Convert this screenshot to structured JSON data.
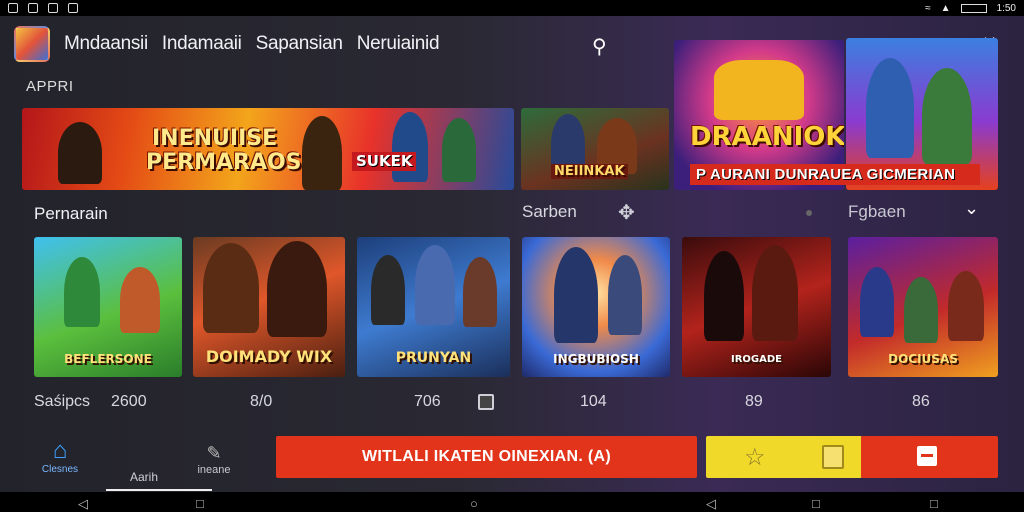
{
  "status_bar": {
    "time": "1:50"
  },
  "header": {
    "tabs": [
      "Mndaansii",
      "Indamaaii",
      "Sapansian",
      "Neruiainid"
    ],
    "section": "APPRI"
  },
  "banners": {
    "b1_title_a": "INENUIISE",
    "b1_title_b": "PERMARAOS",
    "b1_sub": "SUKEK",
    "b2_title": "NEIINKAK",
    "b3_title": "DRAANIOK",
    "b4_caption": "P AURANI DUNRAUEA GICMERIAN"
  },
  "filters": {
    "section_title": "Pernarain",
    "sort_label": "Sarben",
    "filter_label": "Fgbaen"
  },
  "cards": [
    {
      "label": "BEFLERSONE"
    },
    {
      "label": "DOIMADY WIX"
    },
    {
      "label": "PRUNYAN"
    },
    {
      "label": "INGBUBIOSH"
    },
    {
      "label": "IROGADE"
    },
    {
      "label": "DOCIUSAS"
    }
  ],
  "stats": {
    "label": "Saśipcs",
    "values": [
      "2600",
      "8/0",
      "706",
      "104",
      "89",
      "86"
    ]
  },
  "bottom_nav": {
    "home_label": "Clesnes",
    "apps_label": "Aarih",
    "games_label": "ineane"
  },
  "actions": {
    "install_label": "WITLALI IKATEN OINEXIAN.  (A)"
  },
  "icons": {
    "search": "search-icon",
    "close": "close-icon",
    "sort": "sort-icon",
    "dropdown": "chevron-down-icon",
    "home": "home-icon",
    "games": "games-icon",
    "star": "star-icon",
    "bookmark": "bookmark-icon",
    "share": "share-icon"
  },
  "colors": {
    "install_button": "#e2341a",
    "wishlist_button": "#f1d92a",
    "home_accent": "#3ea0ff"
  }
}
